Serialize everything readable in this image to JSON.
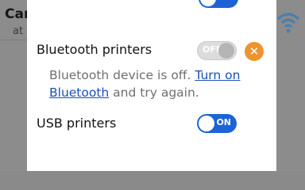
{
  "background": {
    "title": "Can",
    "subtitle": "at"
  },
  "bluetooth": {
    "label": "Bluetooth printers",
    "toggle_label": "OFF",
    "toggle_state": "off",
    "message_prefix": "Bluetooth device is off. ",
    "message_link_line1": "Turn on",
    "message_link_line2": "Bluetooth",
    "message_suffix": " and try again."
  },
  "usb": {
    "label": "USB printers",
    "toggle_label": "ON",
    "toggle_state": "on"
  },
  "colors": {
    "accent": "#1e63d6",
    "warning": "#f0922e",
    "link": "#1a4fb5"
  }
}
